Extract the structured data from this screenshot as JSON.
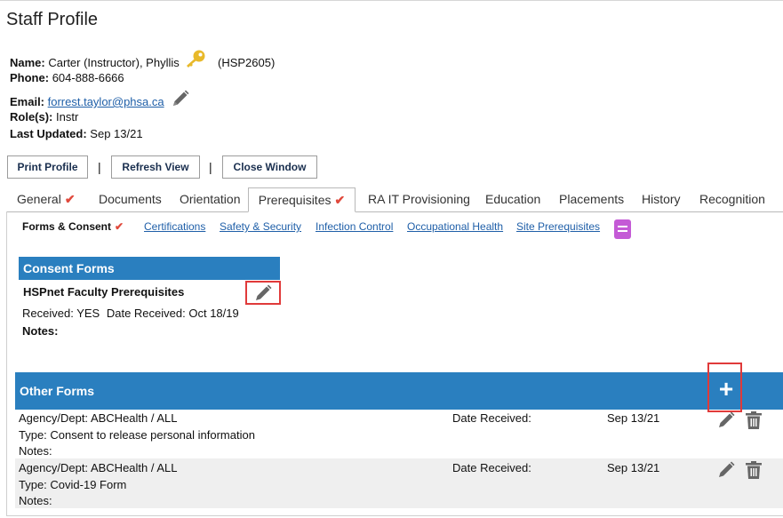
{
  "page": {
    "title": "Staff Profile"
  },
  "profile": {
    "name_label": "Name:",
    "name_value": "Carter (Instructor), Phyllis",
    "staff_id": "(HSP2605)",
    "phone_label": "Phone:",
    "phone_value": "604-888-6666",
    "email_label": "Email:",
    "email_value": "forrest.taylor@phsa.ca",
    "roles_label": "Role(s):",
    "roles_value": "Instr",
    "updated_label": "Last Updated:",
    "updated_value": "Sep 13/21"
  },
  "actions": {
    "print": "Print Profile",
    "refresh": "Refresh View",
    "close": "Close Window",
    "separator": "|"
  },
  "tabs": [
    {
      "label": "General",
      "checked": true
    },
    {
      "label": "Documents"
    },
    {
      "label": "Orientation"
    },
    {
      "label": "Prerequisites",
      "checked": true,
      "active": true
    },
    {
      "label": "RA IT Provisioning"
    },
    {
      "label": "Education"
    },
    {
      "label": "Placements"
    },
    {
      "label": "History"
    },
    {
      "label": "Recognition"
    }
  ],
  "subtabs": [
    {
      "label": "Forms & Consent",
      "active": true,
      "checked": true
    },
    {
      "label": "Certifications"
    },
    {
      "label": "Safety & Security"
    },
    {
      "label": "Infection Control"
    },
    {
      "label": "Occupational Health"
    },
    {
      "label": "Site Prerequisites"
    }
  ],
  "check_mark": "✔",
  "consent": {
    "header": "Consent Forms",
    "item_title": "HSPnet Faculty Prerequisites",
    "received_label": "Received:",
    "received_value": "YES",
    "date_label": "Date Received:",
    "date_value": "Oct 18/19",
    "notes_label": "Notes:"
  },
  "other_forms": {
    "header": "Other Forms",
    "add_symbol": "+",
    "rows": [
      {
        "agency_label": "Agency/Dept:",
        "agency_value": "ABCHealth / ALL",
        "type_label": "Type:",
        "type_value": "Consent to release personal information",
        "notes_label": "Notes:",
        "date_label": "Date Received:",
        "date_value": "Sep 13/21"
      },
      {
        "agency_label": "Agency/Dept:",
        "agency_value": "ABCHealth / ALL",
        "type_label": "Type:",
        "type_value": "Covid-19 Form",
        "notes_label": "Notes:",
        "date_label": "Date Received:",
        "date_value": "Sep 13/21"
      }
    ]
  },
  "colors": {
    "blue_bar": "#2a7fbf",
    "link": "#1f5fa8",
    "check": "#e0493c",
    "highlight_box": "#e03a3a",
    "key_icon": "#e8b92a",
    "book_icon": "#c45ad6"
  },
  "icons": [
    "key-icon",
    "pencil-icon",
    "book-icon",
    "trash-icon",
    "plus-icon"
  ]
}
